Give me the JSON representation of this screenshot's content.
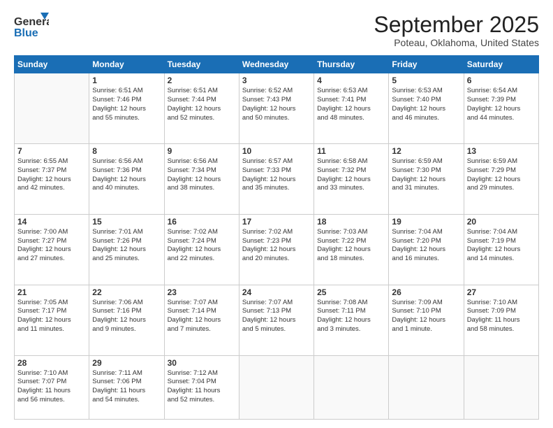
{
  "logo": {
    "line1": "General",
    "line2": "Blue"
  },
  "header": {
    "month": "September 2025",
    "location": "Poteau, Oklahoma, United States"
  },
  "weekdays": [
    "Sunday",
    "Monday",
    "Tuesday",
    "Wednesday",
    "Thursday",
    "Friday",
    "Saturday"
  ],
  "weeks": [
    [
      {
        "day": "",
        "text": ""
      },
      {
        "day": "1",
        "text": "Sunrise: 6:51 AM\nSunset: 7:46 PM\nDaylight: 12 hours\nand 55 minutes."
      },
      {
        "day": "2",
        "text": "Sunrise: 6:51 AM\nSunset: 7:44 PM\nDaylight: 12 hours\nand 52 minutes."
      },
      {
        "day": "3",
        "text": "Sunrise: 6:52 AM\nSunset: 7:43 PM\nDaylight: 12 hours\nand 50 minutes."
      },
      {
        "day": "4",
        "text": "Sunrise: 6:53 AM\nSunset: 7:41 PM\nDaylight: 12 hours\nand 48 minutes."
      },
      {
        "day": "5",
        "text": "Sunrise: 6:53 AM\nSunset: 7:40 PM\nDaylight: 12 hours\nand 46 minutes."
      },
      {
        "day": "6",
        "text": "Sunrise: 6:54 AM\nSunset: 7:39 PM\nDaylight: 12 hours\nand 44 minutes."
      }
    ],
    [
      {
        "day": "7",
        "text": "Sunrise: 6:55 AM\nSunset: 7:37 PM\nDaylight: 12 hours\nand 42 minutes."
      },
      {
        "day": "8",
        "text": "Sunrise: 6:56 AM\nSunset: 7:36 PM\nDaylight: 12 hours\nand 40 minutes."
      },
      {
        "day": "9",
        "text": "Sunrise: 6:56 AM\nSunset: 7:34 PM\nDaylight: 12 hours\nand 38 minutes."
      },
      {
        "day": "10",
        "text": "Sunrise: 6:57 AM\nSunset: 7:33 PM\nDaylight: 12 hours\nand 35 minutes."
      },
      {
        "day": "11",
        "text": "Sunrise: 6:58 AM\nSunset: 7:32 PM\nDaylight: 12 hours\nand 33 minutes."
      },
      {
        "day": "12",
        "text": "Sunrise: 6:59 AM\nSunset: 7:30 PM\nDaylight: 12 hours\nand 31 minutes."
      },
      {
        "day": "13",
        "text": "Sunrise: 6:59 AM\nSunset: 7:29 PM\nDaylight: 12 hours\nand 29 minutes."
      }
    ],
    [
      {
        "day": "14",
        "text": "Sunrise: 7:00 AM\nSunset: 7:27 PM\nDaylight: 12 hours\nand 27 minutes."
      },
      {
        "day": "15",
        "text": "Sunrise: 7:01 AM\nSunset: 7:26 PM\nDaylight: 12 hours\nand 25 minutes."
      },
      {
        "day": "16",
        "text": "Sunrise: 7:02 AM\nSunset: 7:24 PM\nDaylight: 12 hours\nand 22 minutes."
      },
      {
        "day": "17",
        "text": "Sunrise: 7:02 AM\nSunset: 7:23 PM\nDaylight: 12 hours\nand 20 minutes."
      },
      {
        "day": "18",
        "text": "Sunrise: 7:03 AM\nSunset: 7:22 PM\nDaylight: 12 hours\nand 18 minutes."
      },
      {
        "day": "19",
        "text": "Sunrise: 7:04 AM\nSunset: 7:20 PM\nDaylight: 12 hours\nand 16 minutes."
      },
      {
        "day": "20",
        "text": "Sunrise: 7:04 AM\nSunset: 7:19 PM\nDaylight: 12 hours\nand 14 minutes."
      }
    ],
    [
      {
        "day": "21",
        "text": "Sunrise: 7:05 AM\nSunset: 7:17 PM\nDaylight: 12 hours\nand 11 minutes."
      },
      {
        "day": "22",
        "text": "Sunrise: 7:06 AM\nSunset: 7:16 PM\nDaylight: 12 hours\nand 9 minutes."
      },
      {
        "day": "23",
        "text": "Sunrise: 7:07 AM\nSunset: 7:14 PM\nDaylight: 12 hours\nand 7 minutes."
      },
      {
        "day": "24",
        "text": "Sunrise: 7:07 AM\nSunset: 7:13 PM\nDaylight: 12 hours\nand 5 minutes."
      },
      {
        "day": "25",
        "text": "Sunrise: 7:08 AM\nSunset: 7:11 PM\nDaylight: 12 hours\nand 3 minutes."
      },
      {
        "day": "26",
        "text": "Sunrise: 7:09 AM\nSunset: 7:10 PM\nDaylight: 12 hours\nand 1 minute."
      },
      {
        "day": "27",
        "text": "Sunrise: 7:10 AM\nSunset: 7:09 PM\nDaylight: 11 hours\nand 58 minutes."
      }
    ],
    [
      {
        "day": "28",
        "text": "Sunrise: 7:10 AM\nSunset: 7:07 PM\nDaylight: 11 hours\nand 56 minutes."
      },
      {
        "day": "29",
        "text": "Sunrise: 7:11 AM\nSunset: 7:06 PM\nDaylight: 11 hours\nand 54 minutes."
      },
      {
        "day": "30",
        "text": "Sunrise: 7:12 AM\nSunset: 7:04 PM\nDaylight: 11 hours\nand 52 minutes."
      },
      {
        "day": "",
        "text": ""
      },
      {
        "day": "",
        "text": ""
      },
      {
        "day": "",
        "text": ""
      },
      {
        "day": "",
        "text": ""
      }
    ]
  ]
}
